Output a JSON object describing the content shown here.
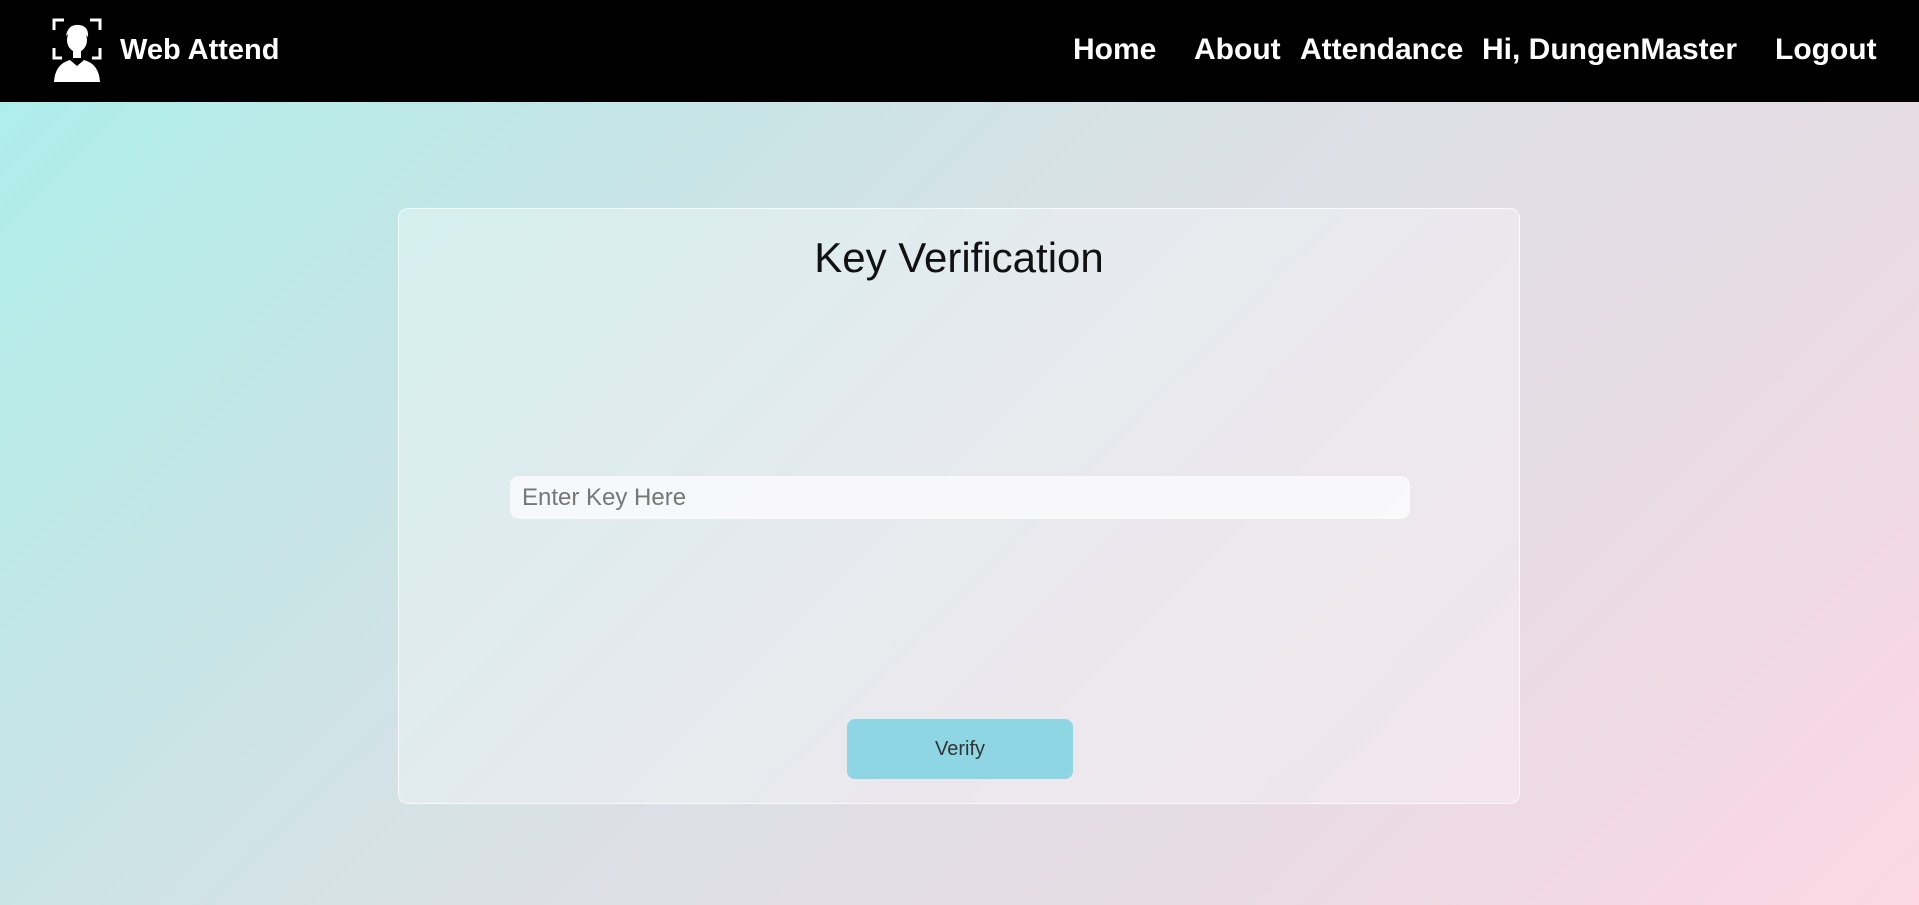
{
  "navbar": {
    "brand_name": "Web Attend",
    "brand_icon": "face-scan-user-icon",
    "links": {
      "home": "Home",
      "about": "About",
      "attendance": "Attendance",
      "greeting": "Hi, DungenMaster",
      "logout": "Logout"
    }
  },
  "card": {
    "title": "Key Verification",
    "key_input": {
      "value": "",
      "placeholder": "Enter Key Here"
    },
    "verify_label": "Verify"
  },
  "colors": {
    "navbar_bg": "#000000",
    "button_bg": "#8fd6e5",
    "gradient_start": "#aeeeea",
    "gradient_end": "#fdd7e4"
  }
}
